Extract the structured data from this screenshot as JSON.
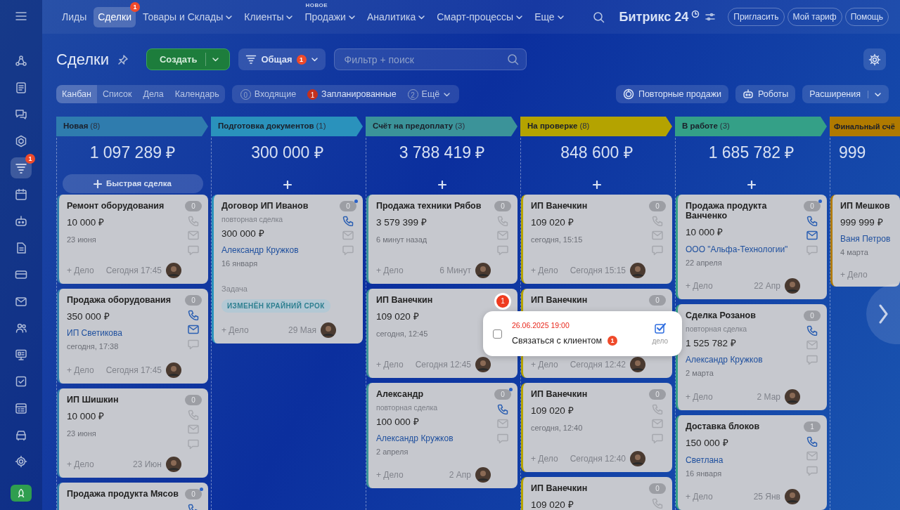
{
  "sidebar": {
    "items": [
      {
        "selected": false
      },
      {
        "selected": false
      },
      {
        "selected": false
      },
      {
        "selected": false
      },
      {
        "selected": true,
        "badge": "1"
      },
      {
        "selected": false
      },
      {
        "selected": false
      },
      {
        "selected": false
      },
      {
        "selected": false
      },
      {
        "selected": false
      },
      {
        "selected": false
      },
      {
        "selected": false
      },
      {
        "selected": false
      },
      {
        "selected": false
      },
      {
        "selected": false
      },
      {
        "selected": false
      }
    ]
  },
  "nav": {
    "items": [
      {
        "label": "Лиды",
        "selected": false,
        "dropdown": false
      },
      {
        "label": "Сделки",
        "selected": true,
        "dropdown": false,
        "badge": "1"
      },
      {
        "label": "Товары и Склады",
        "selected": false,
        "dropdown": true
      },
      {
        "label": "Клиенты",
        "selected": false,
        "dropdown": true
      },
      {
        "label": "Продажи",
        "selected": false,
        "dropdown": true,
        "note": "НОВОЕ"
      },
      {
        "label": "Аналитика",
        "selected": false,
        "dropdown": true
      },
      {
        "label": "Смарт-процессы",
        "selected": false,
        "dropdown": true
      },
      {
        "label": "Еще",
        "selected": false,
        "dropdown": true
      }
    ],
    "logo": "Битрикс 24",
    "buttons": [
      "Пригласить",
      "Мой тариф",
      "Помощь"
    ]
  },
  "header": {
    "title": "Сделки",
    "create": "Создать",
    "filter": {
      "label": "Общая",
      "badge": "1"
    },
    "search": {
      "placeholder": "Фильтр + поиск"
    }
  },
  "views": [
    {
      "label": "Канбан",
      "selected": true
    },
    {
      "label": "Список",
      "selected": false
    },
    {
      "label": "Дела",
      "selected": false
    },
    {
      "label": "Календарь",
      "selected": false
    }
  ],
  "counters": [
    {
      "count": "0",
      "label": "Входящие",
      "alert": false,
      "dropdown": false
    },
    {
      "count": "1",
      "label": "Запланированные",
      "alert": true,
      "dropdown": false
    },
    {
      "count": "2",
      "label": "Ещё",
      "alert": false,
      "dropdown": true
    }
  ],
  "actions": [
    {
      "label": "Повторные продажи",
      "kind": "repeat"
    },
    {
      "label": "Роботы",
      "kind": "robot"
    },
    {
      "label": "Расширения",
      "kind": "split"
    }
  ],
  "columns": [
    {
      "title": "Новая",
      "count": "(8)",
      "color": "#2f7cae",
      "sum": "1 097 289 ₽",
      "quick": "Быстрая сделка",
      "cards": [
        {
          "title": "Ремонт оборудования",
          "amount": "10 000 ₽",
          "date": "23 июня",
          "add": "+ Дело",
          "time": "Сегодня 17:45",
          "counter": "0",
          "alert": false,
          "dot": false,
          "phone": false,
          "mail": false
        },
        {
          "title": "Продажа оборудования",
          "amount": "350 000 ₽",
          "contact": "ИП Светикова",
          "date": "сегодня, 17:38",
          "add": "+ Дело",
          "time": "Сегодня 17:45",
          "counter": "0",
          "alert": false,
          "dot": false,
          "phone": true,
          "mail": true
        },
        {
          "title": "ИП Шишкин",
          "amount": "10 000 ₽",
          "date": "23 июня",
          "add": "+ Дело",
          "time": "23 Июн",
          "counter": "0",
          "alert": false,
          "dot": false,
          "phone": false,
          "mail": false
        },
        {
          "title": "Продажа продукта Мясов",
          "counter": "0",
          "alert": false,
          "dot": true,
          "phone": true
        }
      ]
    },
    {
      "title": "Подготовка документов",
      "count": "(1)",
      "color": "#2a92bc",
      "sum": "300 000 ₽",
      "cards": [
        {
          "title": "Договор ИП Иванов",
          "subtitle": "повторная сделка",
          "amount": "300 000 ₽",
          "contact": "Александр Кружков",
          "date": "16 января",
          "task": {
            "label": "Задача",
            "badge": "ИЗМЕНЁН КРАЙНИЙ СРОК"
          },
          "add": "+ Дело",
          "time": "29 Мая",
          "counter": "0",
          "alert": false,
          "dot": true,
          "phone": true,
          "mail": false
        }
      ]
    },
    {
      "title": "Счёт на предоплату",
      "count": "(3)",
      "color": "#3b9399",
      "sum": "3 788 419 ₽",
      "cards": [
        {
          "title": "Продажа техники Рябов",
          "amount": "3 579 399 ₽",
          "date": "6 минут назад",
          "add": "+ Дело",
          "time": "6 Минут",
          "counter": "0",
          "alert": false,
          "dot": false,
          "phone": false,
          "mail": false
        },
        {
          "title": "ИП Ванечкин",
          "amount": "109 020 ₽",
          "date": "сегодня, 12:45",
          "add": "+ Дело",
          "time": "Сегодня 12:45",
          "counter": "1",
          "alert": true,
          "dot": false
        },
        {
          "title": "Александр",
          "subtitle": "повторная сделка",
          "amount": "100 000 ₽",
          "contact": "Александр Кружков",
          "date": "2 апреля",
          "add": "+ Дело",
          "time": "2 Апр",
          "counter": "0",
          "alert": false,
          "dot": true,
          "phone": true,
          "mail": false
        }
      ]
    },
    {
      "title": "На проверке",
      "count": "(8)",
      "color": "#b4a300",
      "sum": "848 600 ₽",
      "cards": [
        {
          "title": "ИП Ванечкин",
          "amount": "109 020 ₽",
          "date": "сегодня, 15:15",
          "add": "+ Дело",
          "time": "Сегодня 15:15",
          "counter": "0",
          "alert": false,
          "dot": false,
          "phone": false,
          "mail": false
        },
        {
          "title": "ИП Ванечкин",
          "add": "+ Дело",
          "time": "Сегодня 12:42",
          "counter": "0",
          "alert": false,
          "dot": false
        },
        {
          "title": "ИП Ванечкин",
          "amount": "109 020 ₽",
          "date": "сегодня, 12:40",
          "add": "+ Дело",
          "time": "Сегодня 12:40",
          "counter": "0",
          "alert": false,
          "dot": false,
          "phone": false,
          "mail": false
        },
        {
          "title": "ИП Ванечкин",
          "amount": "109 020 ₽",
          "counter": "0",
          "alert": false,
          "dot": false,
          "phone": false
        }
      ]
    },
    {
      "title": "В работе",
      "count": "(3)",
      "color": "#34a087",
      "sum": "1 685 782 ₽",
      "cards": [
        {
          "title": "Продажа продукта Ванченко",
          "amount": "10 000 ₽",
          "contact": "ООО \"Альфа-Технологии\"",
          "date": "22 апреля",
          "add": "+ Дело",
          "time": "22 Апр",
          "counter": "0",
          "alert": false,
          "dot": true,
          "phone": true,
          "mail": true
        },
        {
          "title": "Сделка Розанов",
          "subtitle": "повторная сделка",
          "amount": "1 525 782 ₽",
          "contact": "Александр Кружков",
          "date": "2 марта",
          "add": "+ Дело",
          "time": "2 Мар",
          "counter": "0",
          "alert": false,
          "dot": false,
          "phone": true,
          "mail": false
        },
        {
          "title": "Доставка блоков",
          "amount": "150 000 ₽",
          "contact": "Светлана",
          "date": "16 января",
          "add": "+ Дело",
          "time": "25 Янв",
          "counter": "1",
          "alert": false,
          "dot": false,
          "phone": true,
          "mail": false
        }
      ]
    },
    {
      "title": "Финальный счё",
      "color": "#b07a00",
      "sum": "999",
      "cut": true,
      "cards": [
        {
          "title": "ИП Мешков",
          "amount": "999 999 ₽",
          "contact": "Ваня Петров",
          "date": "4 марта",
          "add": "+ Дело"
        }
      ]
    }
  ],
  "popup": {
    "checked": false,
    "date": "26.06.2025 19:00",
    "text": "Связаться с клиентом",
    "badge": "1",
    "action": "дело"
  }
}
